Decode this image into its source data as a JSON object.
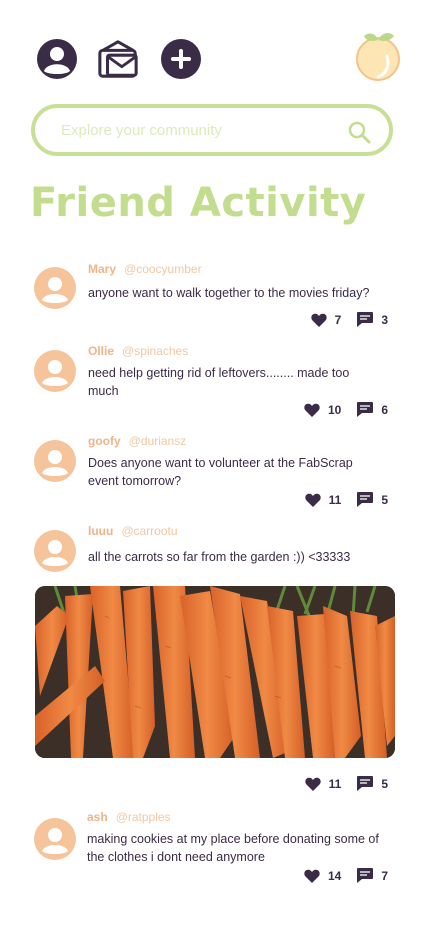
{
  "search": {
    "placeholder": "Explore your community"
  },
  "page_title": "Friend Activity",
  "colors": {
    "accent_green": "#c3dd8e",
    "peach": "#f5c49b",
    "dark": "#3a2b47"
  },
  "icons": [
    "profile-icon",
    "inbox-icon",
    "add-icon",
    "peach-logo-icon",
    "search-icon",
    "heart-icon",
    "comment-icon"
  ],
  "posts": [
    {
      "name": "Mary",
      "handle": "@coocyumber",
      "text": "anyone want to walk together to the movies friday?",
      "likes": "7",
      "comments": "3"
    },
    {
      "name": "Ollie",
      "handle": "@spinaches",
      "text": "need help getting rid of leftovers........ made too much",
      "likes": "10",
      "comments": "6"
    },
    {
      "name": "goofy",
      "handle": "@duriansz",
      "text": "Does anyone want to volunteer at the FabScrap event tomorrow?",
      "likes": "11",
      "comments": "5"
    },
    {
      "name": "luuu",
      "handle": "@carrootu",
      "text": "all the carrots so far from the garden :)) <33333",
      "likes": "11",
      "comments": "5"
    },
    {
      "name": "ash",
      "handle": "@ratpples",
      "text": "making cookies at my place before donating some of the clothes i dont need anymore",
      "likes": "14",
      "comments": "7"
    }
  ]
}
